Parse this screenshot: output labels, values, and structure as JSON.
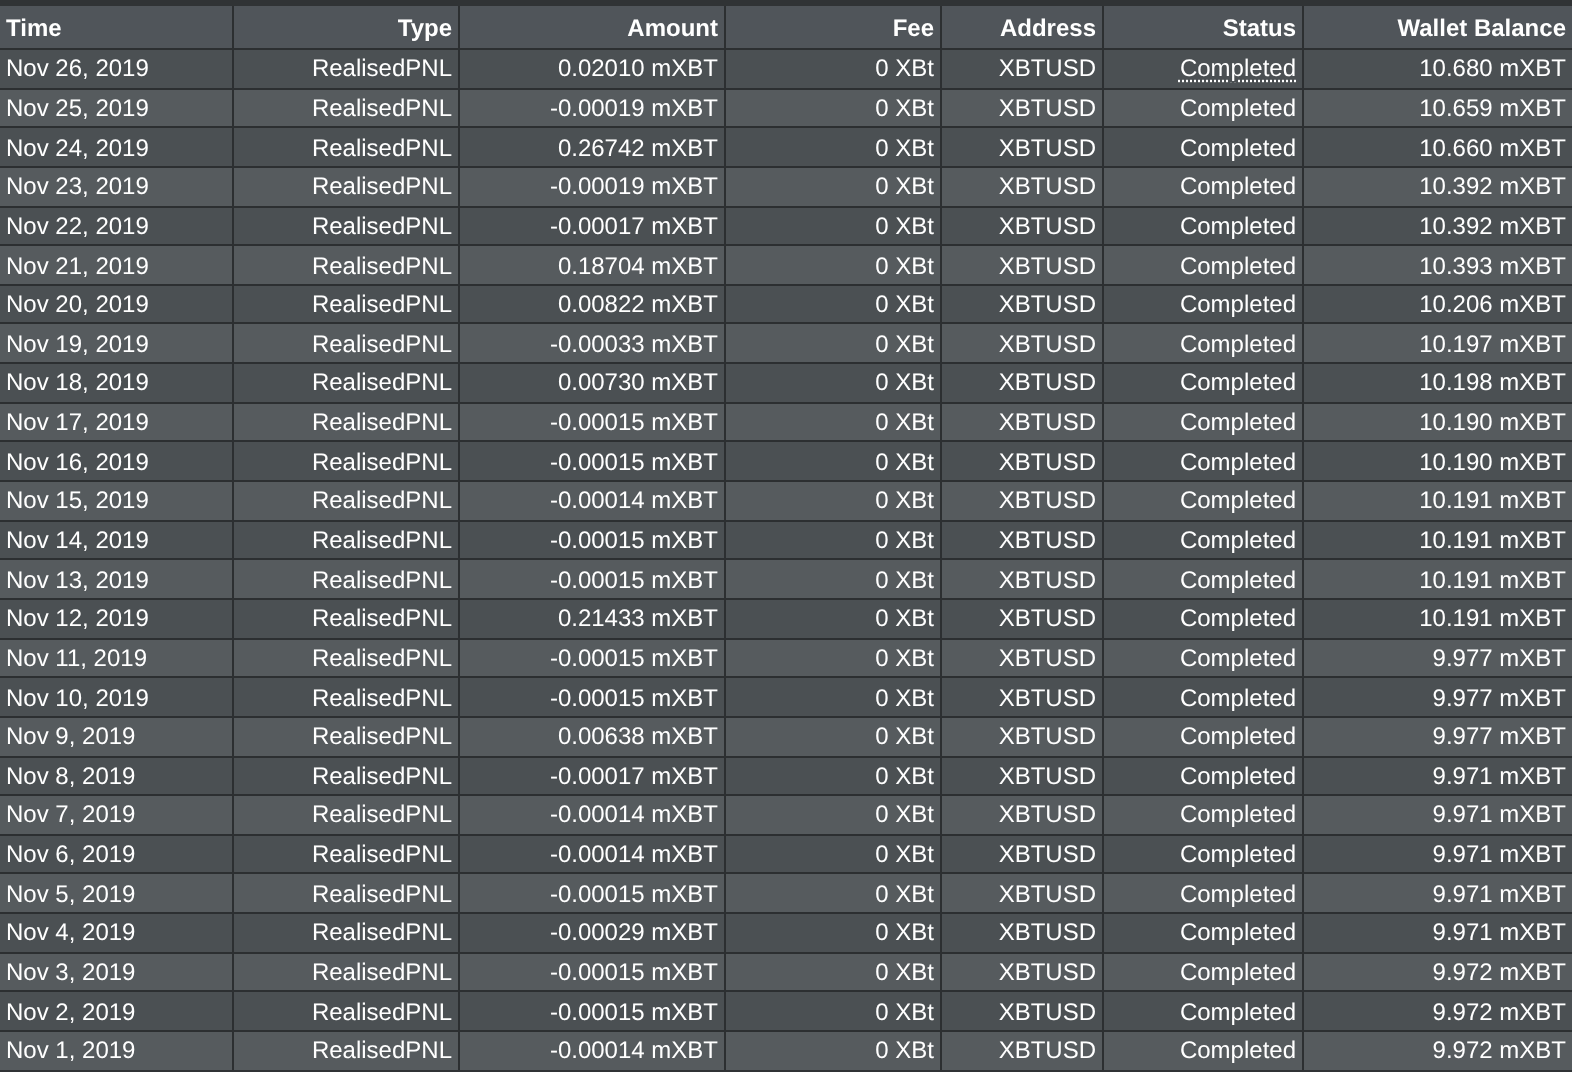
{
  "table": {
    "columns": [
      "Time",
      "Type",
      "Amount",
      "Fee",
      "Address",
      "Status",
      "Wallet Balance"
    ],
    "rows": [
      {
        "time": "Nov 26, 2019",
        "type": "RealisedPNL",
        "amount": "0.02010 mXBT",
        "fee": "0 XBt",
        "address": "XBTUSD",
        "status": "Completed",
        "status_underlined": true,
        "wallet_balance": "10.680 mXBT"
      },
      {
        "time": "Nov 25, 2019",
        "type": "RealisedPNL",
        "amount": "-0.00019 mXBT",
        "fee": "0 XBt",
        "address": "XBTUSD",
        "status": "Completed",
        "status_underlined": false,
        "wallet_balance": "10.659 mXBT"
      },
      {
        "time": "Nov 24, 2019",
        "type": "RealisedPNL",
        "amount": "0.26742 mXBT",
        "fee": "0 XBt",
        "address": "XBTUSD",
        "status": "Completed",
        "status_underlined": false,
        "wallet_balance": "10.660 mXBT"
      },
      {
        "time": "Nov 23, 2019",
        "type": "RealisedPNL",
        "amount": "-0.00019 mXBT",
        "fee": "0 XBt",
        "address": "XBTUSD",
        "status": "Completed",
        "status_underlined": false,
        "wallet_balance": "10.392 mXBT"
      },
      {
        "time": "Nov 22, 2019",
        "type": "RealisedPNL",
        "amount": "-0.00017 mXBT",
        "fee": "0 XBt",
        "address": "XBTUSD",
        "status": "Completed",
        "status_underlined": false,
        "wallet_balance": "10.392 mXBT"
      },
      {
        "time": "Nov 21, 2019",
        "type": "RealisedPNL",
        "amount": "0.18704 mXBT",
        "fee": "0 XBt",
        "address": "XBTUSD",
        "status": "Completed",
        "status_underlined": false,
        "wallet_balance": "10.393 mXBT"
      },
      {
        "time": "Nov 20, 2019",
        "type": "RealisedPNL",
        "amount": "0.00822 mXBT",
        "fee": "0 XBt",
        "address": "XBTUSD",
        "status": "Completed",
        "status_underlined": false,
        "wallet_balance": "10.206 mXBT"
      },
      {
        "time": "Nov 19, 2019",
        "type": "RealisedPNL",
        "amount": "-0.00033 mXBT",
        "fee": "0 XBt",
        "address": "XBTUSD",
        "status": "Completed",
        "status_underlined": false,
        "wallet_balance": "10.197 mXBT"
      },
      {
        "time": "Nov 18, 2019",
        "type": "RealisedPNL",
        "amount": "0.00730 mXBT",
        "fee": "0 XBt",
        "address": "XBTUSD",
        "status": "Completed",
        "status_underlined": false,
        "wallet_balance": "10.198 mXBT"
      },
      {
        "time": "Nov 17, 2019",
        "type": "RealisedPNL",
        "amount": "-0.00015 mXBT",
        "fee": "0 XBt",
        "address": "XBTUSD",
        "status": "Completed",
        "status_underlined": false,
        "wallet_balance": "10.190 mXBT"
      },
      {
        "time": "Nov 16, 2019",
        "type": "RealisedPNL",
        "amount": "-0.00015 mXBT",
        "fee": "0 XBt",
        "address": "XBTUSD",
        "status": "Completed",
        "status_underlined": false,
        "wallet_balance": "10.190 mXBT"
      },
      {
        "time": "Nov 15, 2019",
        "type": "RealisedPNL",
        "amount": "-0.00014 mXBT",
        "fee": "0 XBt",
        "address": "XBTUSD",
        "status": "Completed",
        "status_underlined": false,
        "wallet_balance": "10.191 mXBT"
      },
      {
        "time": "Nov 14, 2019",
        "type": "RealisedPNL",
        "amount": "-0.00015 mXBT",
        "fee": "0 XBt",
        "address": "XBTUSD",
        "status": "Completed",
        "status_underlined": false,
        "wallet_balance": "10.191 mXBT"
      },
      {
        "time": "Nov 13, 2019",
        "type": "RealisedPNL",
        "amount": "-0.00015 mXBT",
        "fee": "0 XBt",
        "address": "XBTUSD",
        "status": "Completed",
        "status_underlined": false,
        "wallet_balance": "10.191 mXBT"
      },
      {
        "time": "Nov 12, 2019",
        "type": "RealisedPNL",
        "amount": "0.21433 mXBT",
        "fee": "0 XBt",
        "address": "XBTUSD",
        "status": "Completed",
        "status_underlined": false,
        "wallet_balance": "10.191 mXBT"
      },
      {
        "time": "Nov 11, 2019",
        "type": "RealisedPNL",
        "amount": "-0.00015 mXBT",
        "fee": "0 XBt",
        "address": "XBTUSD",
        "status": "Completed",
        "status_underlined": false,
        "wallet_balance": "9.977 mXBT"
      },
      {
        "time": "Nov 10, 2019",
        "type": "RealisedPNL",
        "amount": "-0.00015 mXBT",
        "fee": "0 XBt",
        "address": "XBTUSD",
        "status": "Completed",
        "status_underlined": false,
        "wallet_balance": "9.977 mXBT"
      },
      {
        "time": "Nov 9, 2019",
        "type": "RealisedPNL",
        "amount": "0.00638 mXBT",
        "fee": "0 XBt",
        "address": "XBTUSD",
        "status": "Completed",
        "status_underlined": false,
        "wallet_balance": "9.977 mXBT"
      },
      {
        "time": "Nov 8, 2019",
        "type": "RealisedPNL",
        "amount": "-0.00017 mXBT",
        "fee": "0 XBt",
        "address": "XBTUSD",
        "status": "Completed",
        "status_underlined": false,
        "wallet_balance": "9.971 mXBT"
      },
      {
        "time": "Nov 7, 2019",
        "type": "RealisedPNL",
        "amount": "-0.00014 mXBT",
        "fee": "0 XBt",
        "address": "XBTUSD",
        "status": "Completed",
        "status_underlined": false,
        "wallet_balance": "9.971 mXBT"
      },
      {
        "time": "Nov 6, 2019",
        "type": "RealisedPNL",
        "amount": "-0.00014 mXBT",
        "fee": "0 XBt",
        "address": "XBTUSD",
        "status": "Completed",
        "status_underlined": false,
        "wallet_balance": "9.971 mXBT"
      },
      {
        "time": "Nov 5, 2019",
        "type": "RealisedPNL",
        "amount": "-0.00015 mXBT",
        "fee": "0 XBt",
        "address": "XBTUSD",
        "status": "Completed",
        "status_underlined": false,
        "wallet_balance": "9.971 mXBT"
      },
      {
        "time": "Nov 4, 2019",
        "type": "RealisedPNL",
        "amount": "-0.00029 mXBT",
        "fee": "0 XBt",
        "address": "XBTUSD",
        "status": "Completed",
        "status_underlined": false,
        "wallet_balance": "9.971 mXBT"
      },
      {
        "time": "Nov 3, 2019",
        "type": "RealisedPNL",
        "amount": "-0.00015 mXBT",
        "fee": "0 XBt",
        "address": "XBTUSD",
        "status": "Completed",
        "status_underlined": false,
        "wallet_balance": "9.972 mXBT"
      },
      {
        "time": "Nov 2, 2019",
        "type": "RealisedPNL",
        "amount": "-0.00015 mXBT",
        "fee": "0 XBt",
        "address": "XBTUSD",
        "status": "Completed",
        "status_underlined": false,
        "wallet_balance": "9.972 mXBT"
      },
      {
        "time": "Nov 1, 2019",
        "type": "RealisedPNL",
        "amount": "-0.00014 mXBT",
        "fee": "0 XBt",
        "address": "XBTUSD",
        "status": "Completed",
        "status_underlined": false,
        "wallet_balance": "9.972 mXBT"
      }
    ]
  }
}
